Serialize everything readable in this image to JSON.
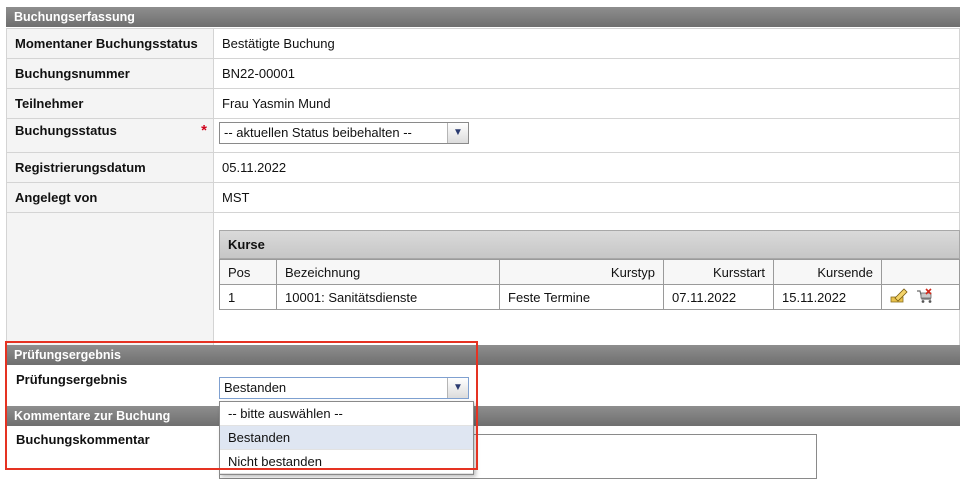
{
  "sections": {
    "booking_title": "Buchungserfassung",
    "exam_title": "Prüfungsergebnis",
    "comments_title": "Kommentare zur Buchung"
  },
  "fields": {
    "status_label": "Momentaner Buchungsstatus",
    "status_value": "Bestätigte Buchung",
    "number_label": "Buchungsnummer",
    "number_value": "BN22-00001",
    "participant_label": "Teilnehmer",
    "participant_value": "Frau Yasmin Mund",
    "booking_status_label": "Buchungsstatus",
    "required_mark": "*",
    "booking_status_select": "-- aktuellen Status beibehalten --",
    "reg_date_label": "Registrierungsdatum",
    "reg_date_value": "05.11.2022",
    "created_by_label": "Angelegt von",
    "created_by_value": "MST"
  },
  "kurse": {
    "title": "Kurse",
    "headers": [
      "Pos",
      "Bezeichnung",
      "Kurstyp",
      "Kursstart",
      "Kursende"
    ],
    "rows": [
      {
        "pos": "1",
        "bezeichnung": "10001: Sanitätsdienste",
        "kurstyp": "Feste Termine",
        "start": "07.11.2022",
        "ende": "15.11.2022"
      }
    ]
  },
  "exam": {
    "label": "Prüfungsergebnis",
    "selected": "Bestanden",
    "options": [
      "-- bitte auswählen --",
      "Bestanden",
      "Nicht bestanden"
    ]
  },
  "comments": {
    "label": "Buchungskommentar"
  },
  "icons": {
    "edit": "edit-icon",
    "delete": "delete-cart-icon"
  },
  "colors": {
    "header": "#7a7a7a",
    "highlight": "#e53222",
    "required": "#d0021b"
  }
}
